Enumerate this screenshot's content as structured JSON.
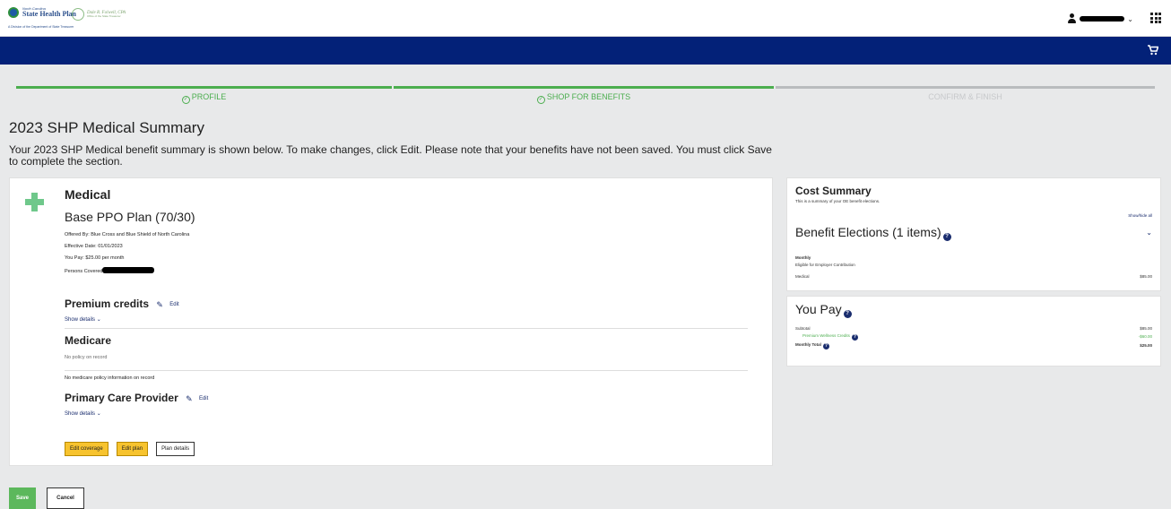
{
  "header": {
    "logo_small": "North Carolina",
    "logo_main": "State Health Plan",
    "logo_sub": "A Division of the Department of State Treasurer",
    "partner_logo_sign": "Dale R. Folwell, CPA",
    "partner_logo_small": "Office of the State Treasurer",
    "user_menu_chevron": "⌄",
    "cart_icon": "shopping-cart-icon",
    "apps_icon": "grid-icon"
  },
  "progress": {
    "steps": [
      {
        "label": "PROFILE",
        "state": "complete",
        "color": "#4cae4f"
      },
      {
        "label": "SHOP FOR BENEFITS",
        "state": "complete",
        "color": "#4cae4f"
      },
      {
        "label": "CONFIRM & FINISH",
        "state": "pending",
        "color": "#b9bcbe"
      }
    ]
  },
  "page": {
    "title": "2023 SHP Medical Summary",
    "intro": "Your 2023 SHP Medical benefit summary is shown below. To make changes, click Edit. Please note that your benefits have not been saved. You must click Save to complete the section."
  },
  "medical": {
    "heading": "Medical",
    "plan_name": "Base PPO Plan (70/30)",
    "offered_by": "Offered By: Blue Cross and Blue Shield of North Carolina",
    "effective_date": "Effective Date: 01/01/2023",
    "you_pay": "You Pay: $25.00 per month",
    "persons_covered": "Persons Covered:",
    "premium_credits": {
      "heading": "Premium credits",
      "edit": "Edit",
      "show_details": "Show details"
    },
    "medicare": {
      "heading": "Medicare",
      "status": "No policy on record",
      "info": "No medicare policy information on record"
    },
    "pcp": {
      "heading": "Primary Care Provider",
      "edit": "Edit",
      "show_details": "Show details"
    },
    "buttons": {
      "edit_coverage": "Edit coverage",
      "edit_plan": "Edit plan",
      "plan_details": "Plan details"
    }
  },
  "cost_summary": {
    "title": "Cost Summary",
    "subtitle": "This is a summary of your OE benefit elections.",
    "show_hide": "Show/hide all",
    "elections_heading": "Benefit Elections (1 items)",
    "frequency": "Monthly",
    "eligible": "Eligible for Employer Contribution",
    "item_label": "Medical",
    "item_amount": "$85.00"
  },
  "you_pay": {
    "title": "You Pay",
    "subtotal_label": "Subtotal",
    "subtotal_amount": "$85.00",
    "credits_label": "Premium Wellness Credits",
    "credits_amount": "-$60.00",
    "total_label": "Monthly Total",
    "total_amount": "$25.00"
  },
  "footer": {
    "save": "Save",
    "cancel": "Cancel"
  }
}
